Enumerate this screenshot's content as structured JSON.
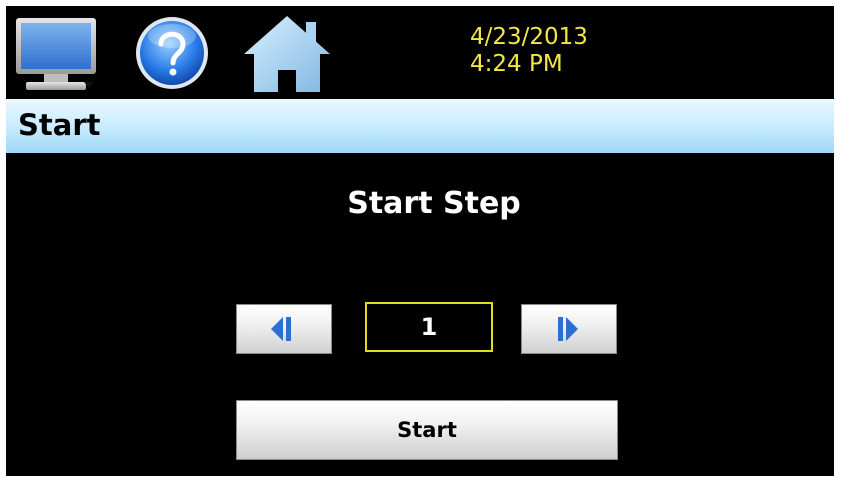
{
  "header": {
    "icons": [
      "monitor-icon",
      "help-icon",
      "home-icon"
    ],
    "date": "4/23/2013",
    "time": "4:24 PM"
  },
  "titlebar": {
    "title": "Start"
  },
  "main": {
    "heading": "Start Step",
    "step_value": "1",
    "start_label": "Start",
    "prev_icon": "step-previous-icon",
    "next_icon": "step-next-icon"
  },
  "colors": {
    "background": "#000000",
    "datetime": "#f4e64a",
    "value_border": "#e6da1c",
    "titlebar": "#bfe7fb"
  }
}
